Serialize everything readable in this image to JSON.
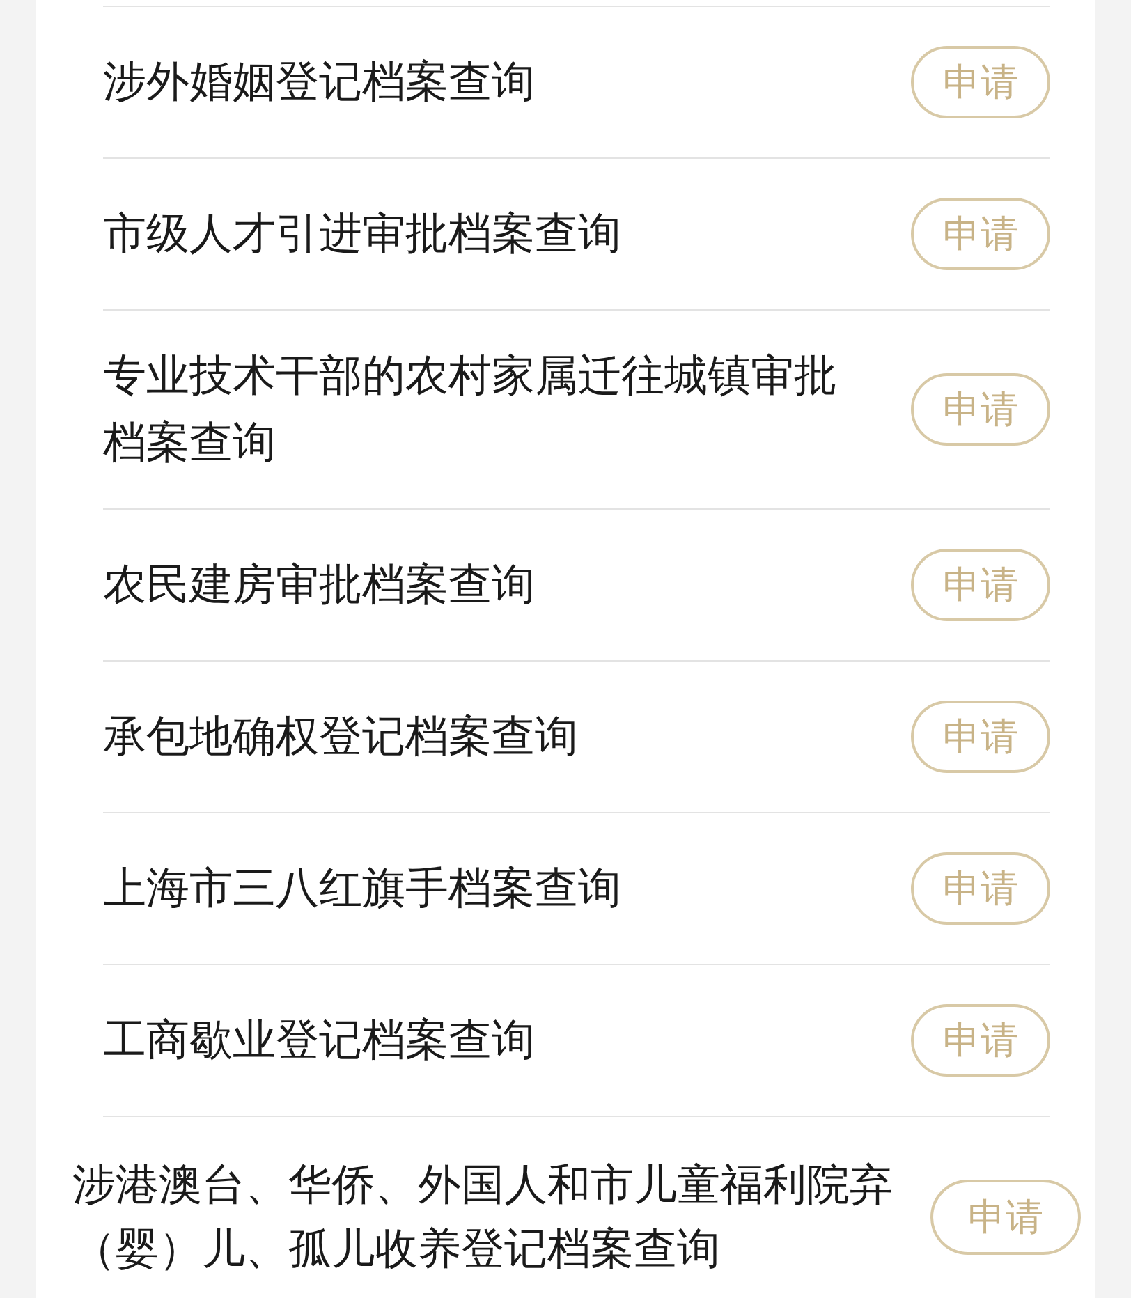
{
  "archive_queries": [
    {
      "kind": "standard",
      "title": "涉外婚姻登记档案查询",
      "button": "申请"
    },
    {
      "kind": "standard",
      "title": "市级人才引进审批档案查询",
      "button": "申请"
    },
    {
      "kind": "standard",
      "title": "专业技术干部的农村家属迁往城镇审批档案查询",
      "button": "申请"
    },
    {
      "kind": "standard",
      "title": "农民建房审批档案查询",
      "button": "申请"
    },
    {
      "kind": "standard",
      "title": "承包地确权登记档案查询",
      "button": "申请"
    },
    {
      "kind": "standard",
      "title": "上海市三八红旗手档案查询",
      "button": "申请"
    },
    {
      "kind": "standard",
      "title": "工商歇业登记档案查询",
      "button": "申请"
    },
    {
      "kind": "wide",
      "title": "涉港澳台、华侨、外国人和市儿童福利院弃（婴）儿、孤儿收养登记档案查询",
      "button": "申请"
    }
  ]
}
